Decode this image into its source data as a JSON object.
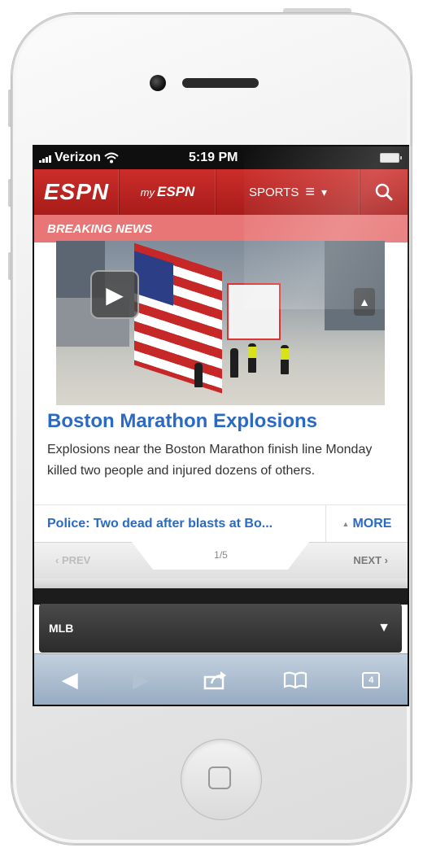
{
  "status_bar": {
    "carrier": "Verizon",
    "time": "5:19 PM",
    "wifi_icon": "wifi-icon",
    "battery_icon": "battery-icon"
  },
  "nav": {
    "logo": "ESPN",
    "my_prefix": "my",
    "my_logo": "ESPN",
    "sports_label": "SPORTS",
    "menu_icon": "≡",
    "dropdown_icon": "▾",
    "search_icon": "⌕"
  },
  "breaking": {
    "label": "BREAKING NEWS"
  },
  "story": {
    "headline": "Boston Marathon Explosions",
    "summary": "Explosions near the Boston Marathon finish line Monday killed two people and injured dozens of others.",
    "play_icon": "▶",
    "next_image_icon": "▲"
  },
  "related": {
    "link_text": "Police: Two dead after blasts at Bo...",
    "more_label": "MORE",
    "more_icon": "▲"
  },
  "pager": {
    "prev_label": "‹ PREV",
    "page_count": "1/5",
    "next_label": "NEXT ›"
  },
  "league_select": {
    "value": "MLB",
    "arrow": "▼"
  },
  "safari_toolbar": {
    "back": "◀",
    "forward": "▶",
    "share": "↗",
    "bookmarks": "🕮",
    "tabs_count": "4"
  },
  "colors": {
    "espn_red": "#c0211e",
    "breaking_pink": "#e87676",
    "link_blue": "#2a6ac5",
    "safari_blue": "#a9bacd"
  }
}
